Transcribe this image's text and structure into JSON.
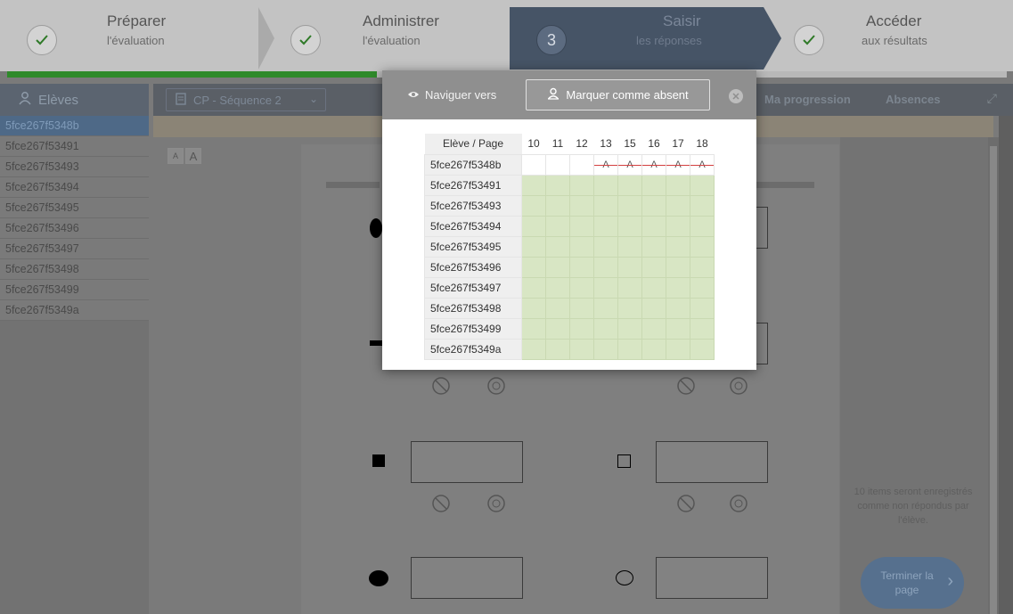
{
  "stepper": {
    "steps": [
      {
        "title": "Préparer",
        "subtitle": "l'évaluation",
        "state": "done"
      },
      {
        "title": "Administrer",
        "subtitle": "l'évaluation",
        "state": "done"
      },
      {
        "number": "3",
        "title": "Saisir",
        "subtitle": "les réponses",
        "state": "active"
      },
      {
        "title": "Accéder",
        "subtitle": "aux résultats",
        "state": "done"
      }
    ],
    "progress_fraction": 0.37
  },
  "sidebar": {
    "header": "Elèves",
    "students": [
      "5fce267f5348b",
      "5fce267f53491",
      "5fce267f53493",
      "5fce267f53494",
      "5fce267f53495",
      "5fce267f53496",
      "5fce267f53497",
      "5fce267f53498",
      "5fce267f53499",
      "5fce267f5349a"
    ],
    "selected_index": 0
  },
  "topbar": {
    "sequence_select": "CP - Séquence 2",
    "tabs": [
      "Ma progression",
      "Absences"
    ]
  },
  "font_buttons": [
    "A",
    "A"
  ],
  "right_panel": {
    "note": "10 items seront enregistrés comme non répondus par l'élève.",
    "finish_button": "Terminer la page"
  },
  "modal": {
    "navigate_label": "Naviguer vers",
    "mark_absent_label": "Marquer comme absent",
    "grid": {
      "header_label": "Elève / Page",
      "pages": [
        "10",
        "11",
        "12",
        "13",
        "15",
        "16",
        "17",
        "18"
      ],
      "rows": [
        {
          "student": "5fce267f5348b",
          "cells": [
            "",
            "",
            "",
            "A",
            "A",
            "A",
            "A",
            "A"
          ]
        },
        {
          "student": "5fce267f53491",
          "cells": [
            "ok",
            "ok",
            "ok",
            "ok",
            "ok",
            "ok",
            "ok",
            "ok"
          ]
        },
        {
          "student": "5fce267f53493",
          "cells": [
            "ok",
            "ok",
            "ok",
            "ok",
            "ok",
            "ok",
            "ok",
            "ok"
          ]
        },
        {
          "student": "5fce267f53494",
          "cells": [
            "ok",
            "ok",
            "ok",
            "ok",
            "ok",
            "ok",
            "ok",
            "ok"
          ]
        },
        {
          "student": "5fce267f53495",
          "cells": [
            "ok",
            "ok",
            "ok",
            "ok",
            "ok",
            "ok",
            "ok",
            "ok"
          ]
        },
        {
          "student": "5fce267f53496",
          "cells": [
            "ok",
            "ok",
            "ok",
            "ok",
            "ok",
            "ok",
            "ok",
            "ok"
          ]
        },
        {
          "student": "5fce267f53497",
          "cells": [
            "ok",
            "ok",
            "ok",
            "ok",
            "ok",
            "ok",
            "ok",
            "ok"
          ]
        },
        {
          "student": "5fce267f53498",
          "cells": [
            "ok",
            "ok",
            "ok",
            "ok",
            "ok",
            "ok",
            "ok",
            "ok"
          ]
        },
        {
          "student": "5fce267f53499",
          "cells": [
            "ok",
            "ok",
            "ok",
            "ok",
            "ok",
            "ok",
            "ok",
            "ok"
          ]
        },
        {
          "student": "5fce267f5349a",
          "cells": [
            "ok",
            "ok",
            "ok",
            "ok",
            "ok",
            "ok",
            "ok",
            "ok"
          ]
        }
      ]
    }
  },
  "colors": {
    "progress_green": "#2f8a2a",
    "active_step": "#465466",
    "grid_done_green": "#d8e6c4",
    "absent_strike": "#d34040"
  }
}
